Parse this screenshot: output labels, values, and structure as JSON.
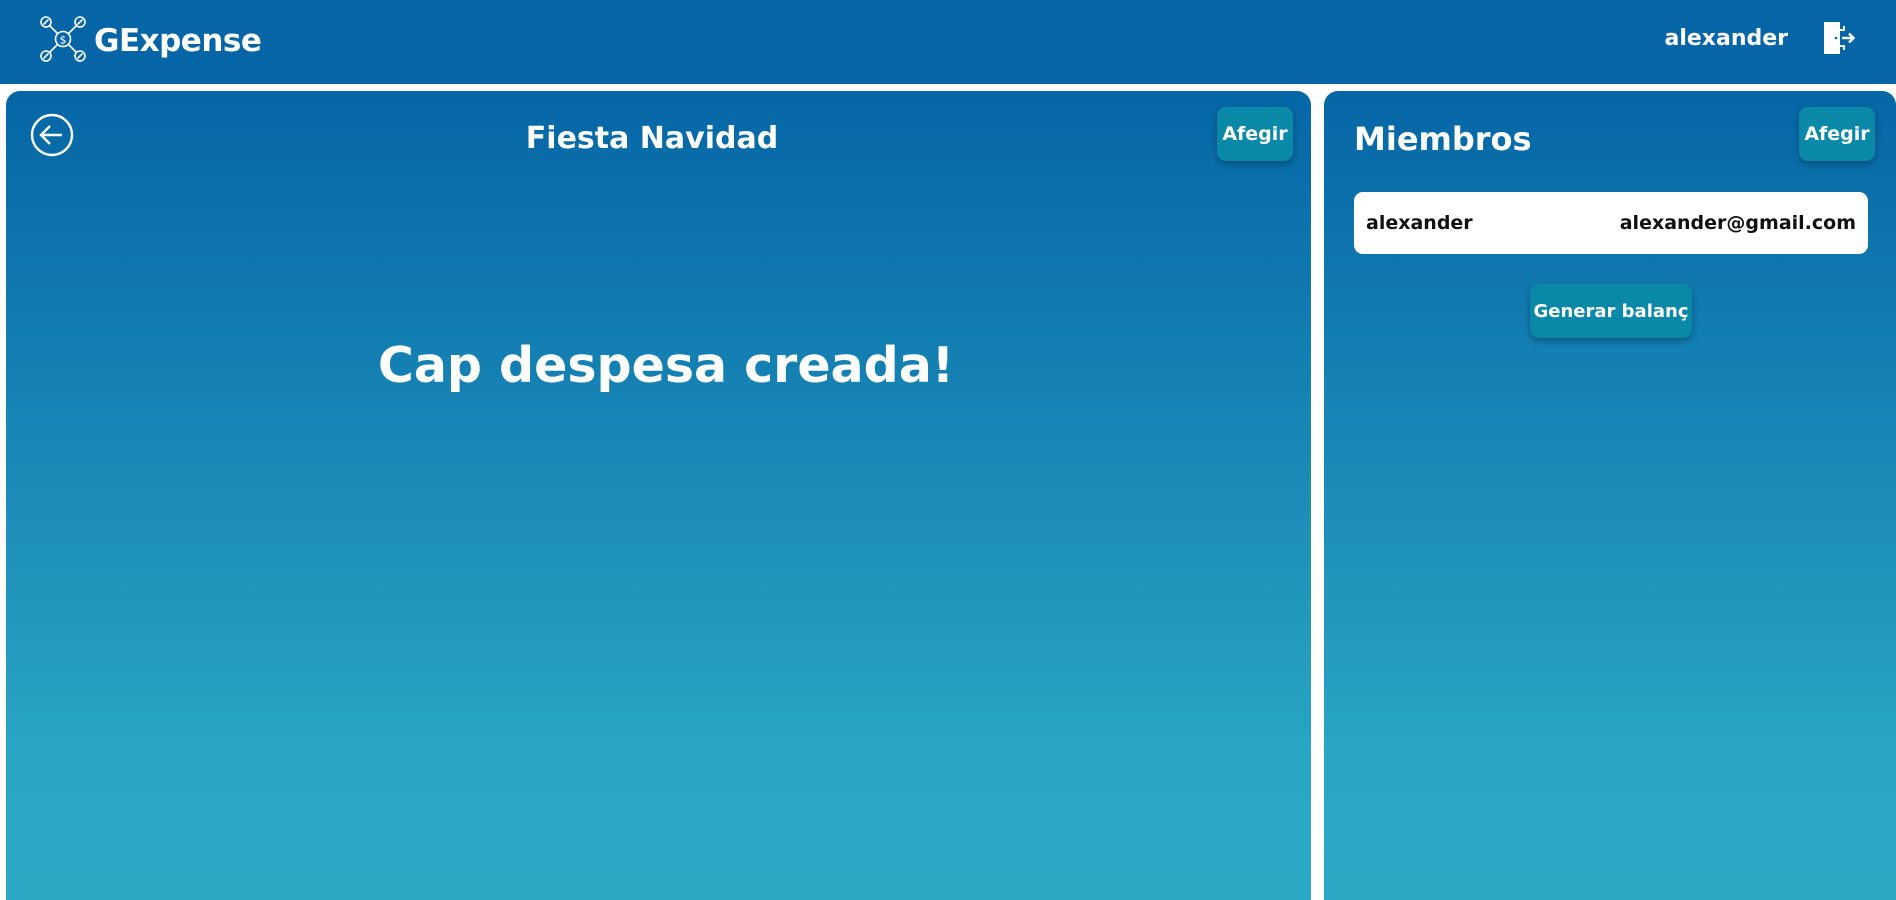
{
  "header": {
    "app_name": "GExpense",
    "user_name": "alexander",
    "logo_icon": "money-network-icon",
    "logout_icon": "logout-door-icon",
    "background_color": "#0565a6"
  },
  "expenses_panel": {
    "back_icon": "arrow-left-circle-icon",
    "title": "Fiesta Navidad",
    "add_label": "Afegir",
    "empty_message": "Cap despesa creada!"
  },
  "members_panel": {
    "title": "Miembros",
    "add_label": "Afegir",
    "members": [
      {
        "name": "alexander",
        "email": "alexander@gmail.com"
      }
    ],
    "balance_label": "Generar balanç"
  },
  "colors": {
    "gradient_top": "#0566a6",
    "gradient_bottom": "#2ca8c5",
    "button": "#0a88a7"
  }
}
